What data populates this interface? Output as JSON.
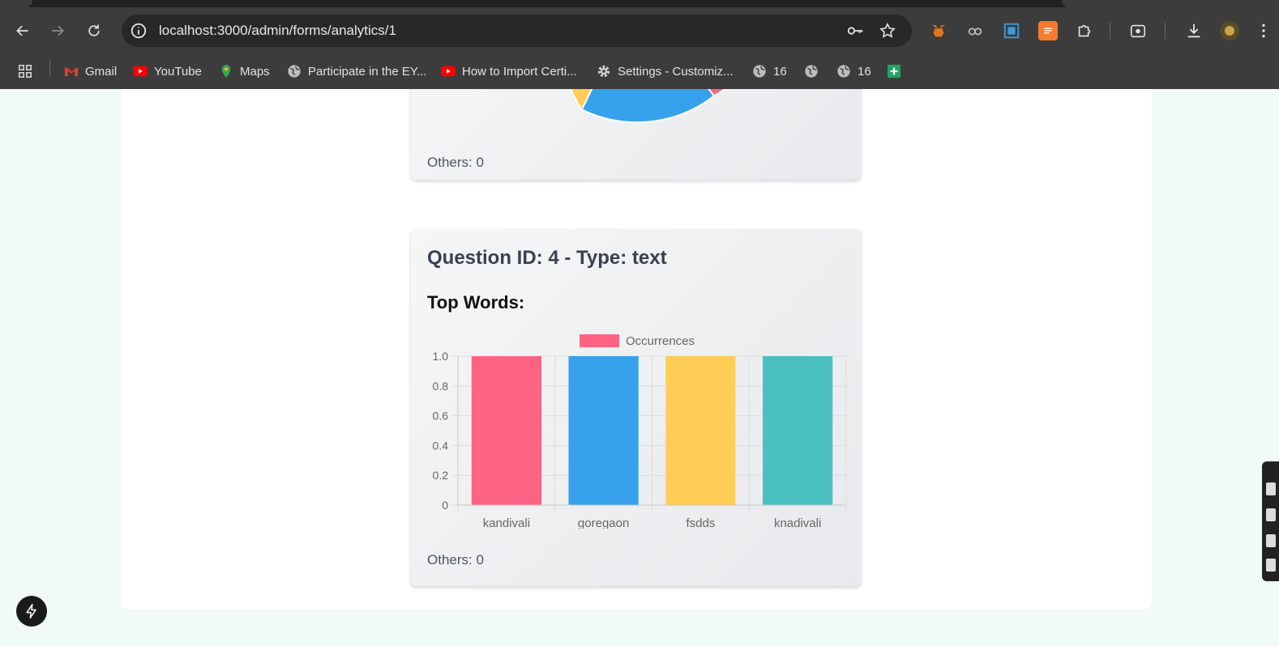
{
  "browser": {
    "url": "localhost:3000/admin/forms/analytics/1",
    "bookmarks": [
      {
        "label": "Gmail",
        "icon": "gmail-icon"
      },
      {
        "label": "YouTube",
        "icon": "youtube-icon"
      },
      {
        "label": "Maps",
        "icon": "maps-icon"
      },
      {
        "label": "Participate in the EY...",
        "icon": "globe-icon"
      },
      {
        "label": "How to Import Certi...",
        "icon": "youtube-icon"
      },
      {
        "label": "Settings - Customiz...",
        "icon": "gear-icon"
      },
      {
        "label": "16",
        "icon": "globe-icon"
      },
      {
        "label": "",
        "icon": "globe-icon"
      },
      {
        "label": "16",
        "icon": "globe-icon"
      },
      {
        "label": "",
        "icon": "sheets-icon"
      }
    ],
    "colors": {
      "chrome_bg": "#3c3c3c",
      "omnibox_bg": "#282828"
    }
  },
  "card_prev": {
    "others": "Others: 0",
    "pie_colors": [
      "#ffcd56",
      "#36a2eb",
      "#ff6384"
    ]
  },
  "card_q4": {
    "title": "Question ID: 4 - Type: text",
    "subtitle": "Top Words:",
    "others": "Others: 0"
  },
  "chart_data": {
    "type": "bar",
    "categories": [
      "kandivali",
      "goregaon",
      "fsdds",
      "knadivali"
    ],
    "series": [
      {
        "name": "Occurrences",
        "values": [
          1,
          1,
          1,
          1
        ]
      }
    ],
    "bar_colors": [
      "#ff6384",
      "#36a2eb",
      "#ffcd56",
      "#4bc0c0"
    ],
    "legend_color": "#ff6384",
    "yticks": [
      "1.0",
      "0.8",
      "0.6",
      "0.4",
      "0.2",
      "0"
    ],
    "ylim": [
      0,
      1
    ],
    "legend": "top-center",
    "grid": true
  }
}
